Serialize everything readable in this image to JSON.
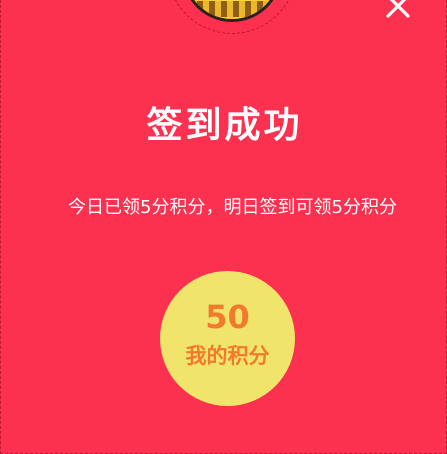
{
  "dialog": {
    "title": "签到成功",
    "message": "今日已领5分积分，明日签到可领5分积分",
    "points_value": "50",
    "points_label": "我的积分",
    "close_icon": "close-icon",
    "medallion_icon": "coin-medallion-icon"
  },
  "colors": {
    "background": "#fc3150",
    "text": "#ffffff",
    "points_circle": "#f1e46b",
    "points_text": "#f27a2e"
  }
}
